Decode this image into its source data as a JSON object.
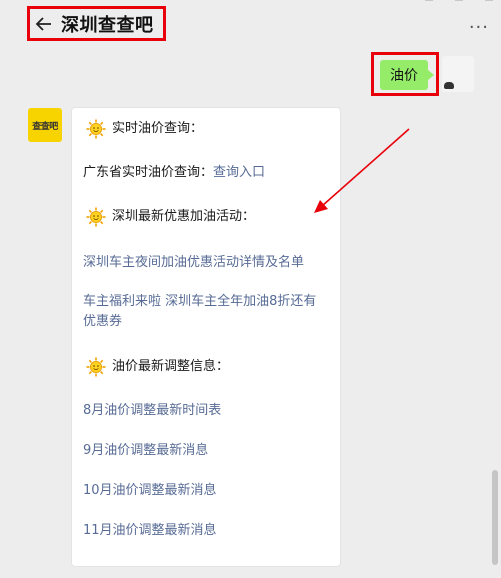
{
  "header": {
    "title": "深圳查查吧",
    "more": "···"
  },
  "sent_message": {
    "text": "油价"
  },
  "bot_avatar": {
    "text": "查查吧"
  },
  "card": {
    "section1_heading": "实时油价查询：",
    "province_label": "广东省实时油价查询：",
    "province_link": "查询入口",
    "section2_heading": "深圳最新优惠加油活动：",
    "link_night": "深圳车主夜间加油优惠活动详情及名单",
    "link_benefit_line1": "车主福利来啦 深圳车主全年加油8折还有",
    "link_benefit_line2": "优惠券",
    "section3_heading": "油价最新调整信息：",
    "link_aug": "8月油价调整最新时间表",
    "link_sep": "9月油价调整最新消息",
    "link_oct": "10月油价调整最新消息",
    "link_nov": "11月油价调整最新消息"
  },
  "colors": {
    "highlight": "#e8000a",
    "link": "#576b95",
    "bubble": "#95ec69",
    "avatar": "#f7d300"
  }
}
